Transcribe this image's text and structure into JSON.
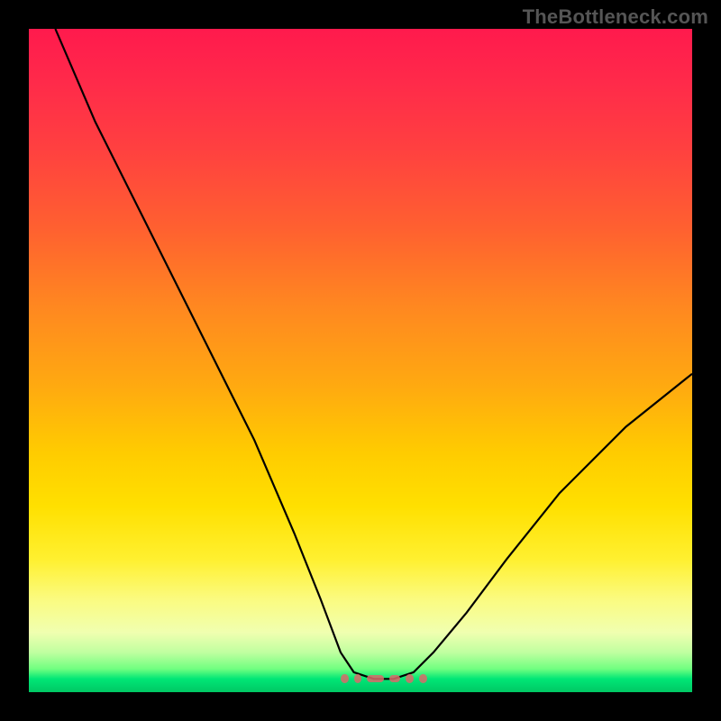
{
  "watermark": "TheBottleneck.com",
  "chart_data": {
    "type": "line",
    "title": "",
    "xlabel": "",
    "ylabel": "",
    "xlim": [
      0,
      100
    ],
    "ylim": [
      0,
      100
    ],
    "grid": false,
    "curve": {
      "description": "V-shaped black curve: steep descent from top-left, minimum plateau near x≈50–58 at y≈2, rising to right edge at y≈48",
      "x": [
        4,
        10,
        18,
        26,
        34,
        40,
        44,
        47,
        49,
        52,
        55,
        58,
        61,
        66,
        72,
        80,
        90,
        100
      ],
      "y": [
        100,
        86,
        70,
        54,
        38,
        24,
        14,
        6,
        3,
        2,
        2,
        3,
        6,
        12,
        20,
        30,
        40,
        48
      ]
    },
    "background_gradient": {
      "orientation": "vertical",
      "stops": [
        {
          "pos": 0.0,
          "color": "#ff1a4d"
        },
        {
          "pos": 0.5,
          "color": "#ffaa10"
        },
        {
          "pos": 0.8,
          "color": "#fff030"
        },
        {
          "pos": 0.96,
          "color": "#70ff80"
        },
        {
          "pos": 1.0,
          "color": "#00c864"
        }
      ]
    },
    "markers": {
      "color": "#d96a6a",
      "x_start": 47,
      "x_end": 60,
      "y": 2
    }
  }
}
